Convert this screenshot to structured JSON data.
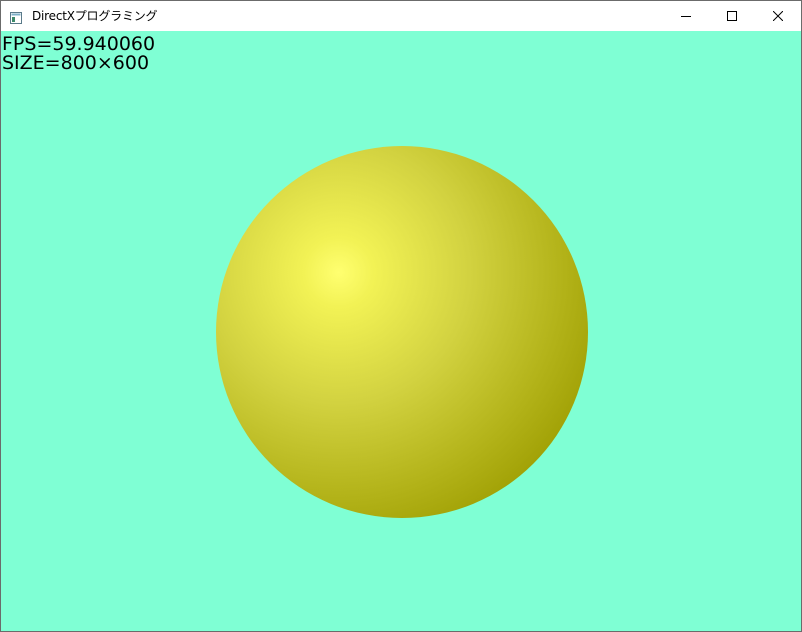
{
  "window": {
    "title": "DirectXプログラミング",
    "icon": "app-window-icon",
    "controls": {
      "minimize_icon": "minimize-icon",
      "maximize_icon": "maximize-icon",
      "close_icon": "close-icon"
    }
  },
  "scene": {
    "clear_color": "#7fffd4",
    "hud": {
      "fps": "FPS=59.940060",
      "size": "SIZE=800×600"
    },
    "sphere": {
      "color_highlight": "#ffff70",
      "color_base": "#d2d240",
      "color_shadow": "#9c9c00"
    }
  }
}
